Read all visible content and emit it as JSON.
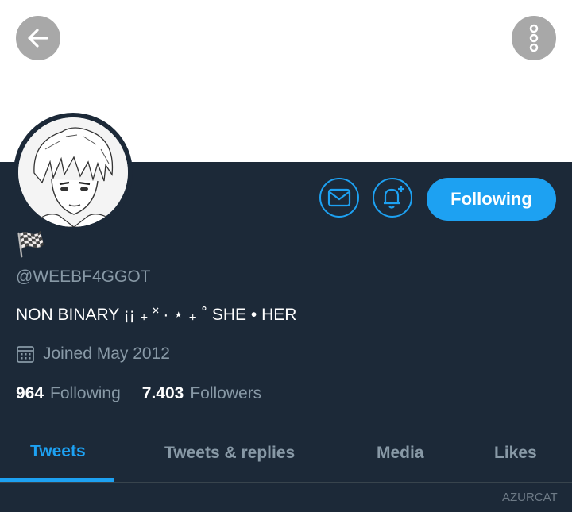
{
  "header": {
    "back_icon": "arrow-left-icon",
    "more_icon": "more-vertical-icon"
  },
  "profile": {
    "flag": "🏁",
    "handle": "@WEEBF4GGOT",
    "bio": "NON BINARY ¡¡ ₊  ˟ ·  ⋆ ₊ ˚ SHE • HER",
    "joined": "Joined May 2012",
    "following_count": "964",
    "following_label": "Following",
    "followers_count": "7.403",
    "followers_label": "Followers"
  },
  "actions": {
    "follow_label": "Following",
    "message_icon": "mail-icon",
    "notify_icon": "bell-plus-icon"
  },
  "tabs": [
    {
      "label": "Tweets"
    },
    {
      "label": "Tweets & replies"
    },
    {
      "label": "Media"
    },
    {
      "label": "Likes"
    }
  ],
  "watermark": "AZURCAT",
  "colors": {
    "accent": "#1da1f2",
    "background": "#1c2938",
    "muted": "#8899a6"
  }
}
